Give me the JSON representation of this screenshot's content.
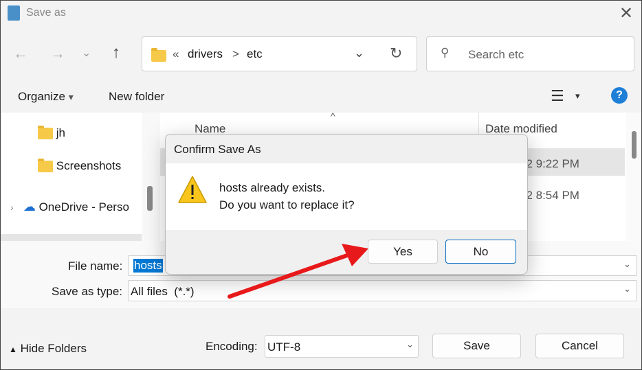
{
  "window": {
    "title": "Save as"
  },
  "nav": {
    "breadcrumb": [
      "«",
      "drivers",
      ">",
      "etc"
    ],
    "search_placeholder": "Search etc"
  },
  "toolbar": {
    "organize": "Organize",
    "new_folder": "New folder",
    "help": "?"
  },
  "sidebar": {
    "items": [
      {
        "label": "jh",
        "icon": "folder-icon"
      },
      {
        "label": "Screenshots",
        "icon": "folder-icon"
      },
      {
        "label": "OneDrive - Perso",
        "icon": "onedrive-icon"
      }
    ]
  },
  "list": {
    "columns": [
      "Name",
      "Date modified"
    ],
    "rows": [
      {
        "date": "22 9:22 PM",
        "selected": true
      },
      {
        "date": "22 8:54 PM",
        "selected": false
      }
    ]
  },
  "form": {
    "file_name_label": "File name:",
    "file_name_value": "hosts",
    "type_label": "Save as type:",
    "type_value": "All files  (*.*)",
    "encoding_label": "Encoding:",
    "encoding_value": "UTF-8",
    "save": "Save",
    "cancel": "Cancel",
    "hide_folders": "Hide Folders"
  },
  "dialog": {
    "title": "Confirm Save As",
    "line1": "hosts already exists.",
    "line2": "Do you want to replace it?",
    "yes": "Yes",
    "no": "No",
    "icon": "warning-icon"
  },
  "annotation": {
    "arrow_color": "#e8191a"
  },
  "colors": {
    "accent": "#0067c0",
    "selection": "#0078d4"
  }
}
